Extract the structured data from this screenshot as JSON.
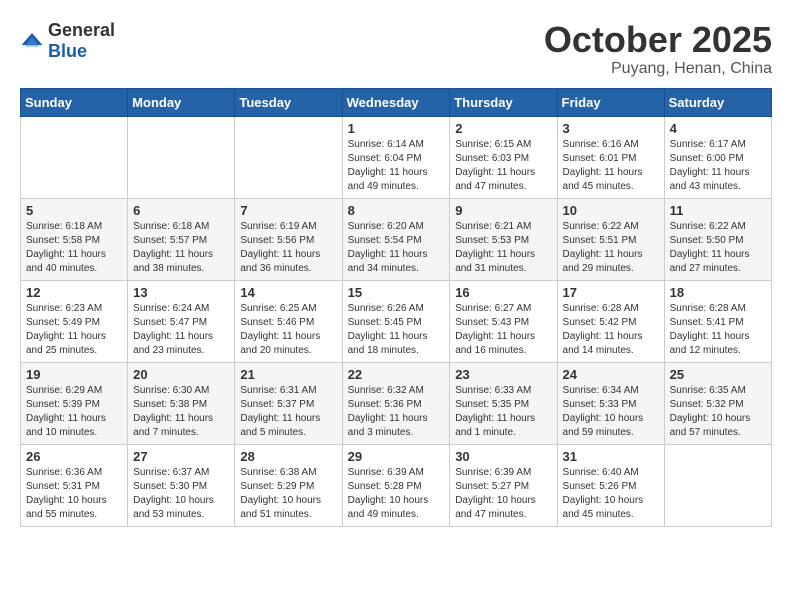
{
  "logo": {
    "general": "General",
    "blue": "Blue"
  },
  "header": {
    "month": "October 2025",
    "location": "Puyang, Henan, China"
  },
  "weekdays": [
    "Sunday",
    "Monday",
    "Tuesday",
    "Wednesday",
    "Thursday",
    "Friday",
    "Saturday"
  ],
  "weeks": [
    [
      {
        "day": "",
        "info": ""
      },
      {
        "day": "",
        "info": ""
      },
      {
        "day": "",
        "info": ""
      },
      {
        "day": "1",
        "info": "Sunrise: 6:14 AM\nSunset: 6:04 PM\nDaylight: 11 hours and 49 minutes."
      },
      {
        "day": "2",
        "info": "Sunrise: 6:15 AM\nSunset: 6:03 PM\nDaylight: 11 hours and 47 minutes."
      },
      {
        "day": "3",
        "info": "Sunrise: 6:16 AM\nSunset: 6:01 PM\nDaylight: 11 hours and 45 minutes."
      },
      {
        "day": "4",
        "info": "Sunrise: 6:17 AM\nSunset: 6:00 PM\nDaylight: 11 hours and 43 minutes."
      }
    ],
    [
      {
        "day": "5",
        "info": "Sunrise: 6:18 AM\nSunset: 5:58 PM\nDaylight: 11 hours and 40 minutes."
      },
      {
        "day": "6",
        "info": "Sunrise: 6:18 AM\nSunset: 5:57 PM\nDaylight: 11 hours and 38 minutes."
      },
      {
        "day": "7",
        "info": "Sunrise: 6:19 AM\nSunset: 5:56 PM\nDaylight: 11 hours and 36 minutes."
      },
      {
        "day": "8",
        "info": "Sunrise: 6:20 AM\nSunset: 5:54 PM\nDaylight: 11 hours and 34 minutes."
      },
      {
        "day": "9",
        "info": "Sunrise: 6:21 AM\nSunset: 5:53 PM\nDaylight: 11 hours and 31 minutes."
      },
      {
        "day": "10",
        "info": "Sunrise: 6:22 AM\nSunset: 5:51 PM\nDaylight: 11 hours and 29 minutes."
      },
      {
        "day": "11",
        "info": "Sunrise: 6:22 AM\nSunset: 5:50 PM\nDaylight: 11 hours and 27 minutes."
      }
    ],
    [
      {
        "day": "12",
        "info": "Sunrise: 6:23 AM\nSunset: 5:49 PM\nDaylight: 11 hours and 25 minutes."
      },
      {
        "day": "13",
        "info": "Sunrise: 6:24 AM\nSunset: 5:47 PM\nDaylight: 11 hours and 23 minutes."
      },
      {
        "day": "14",
        "info": "Sunrise: 6:25 AM\nSunset: 5:46 PM\nDaylight: 11 hours and 20 minutes."
      },
      {
        "day": "15",
        "info": "Sunrise: 6:26 AM\nSunset: 5:45 PM\nDaylight: 11 hours and 18 minutes."
      },
      {
        "day": "16",
        "info": "Sunrise: 6:27 AM\nSunset: 5:43 PM\nDaylight: 11 hours and 16 minutes."
      },
      {
        "day": "17",
        "info": "Sunrise: 6:28 AM\nSunset: 5:42 PM\nDaylight: 11 hours and 14 minutes."
      },
      {
        "day": "18",
        "info": "Sunrise: 6:28 AM\nSunset: 5:41 PM\nDaylight: 11 hours and 12 minutes."
      }
    ],
    [
      {
        "day": "19",
        "info": "Sunrise: 6:29 AM\nSunset: 5:39 PM\nDaylight: 11 hours and 10 minutes."
      },
      {
        "day": "20",
        "info": "Sunrise: 6:30 AM\nSunset: 5:38 PM\nDaylight: 11 hours and 7 minutes."
      },
      {
        "day": "21",
        "info": "Sunrise: 6:31 AM\nSunset: 5:37 PM\nDaylight: 11 hours and 5 minutes."
      },
      {
        "day": "22",
        "info": "Sunrise: 6:32 AM\nSunset: 5:36 PM\nDaylight: 11 hours and 3 minutes."
      },
      {
        "day": "23",
        "info": "Sunrise: 6:33 AM\nSunset: 5:35 PM\nDaylight: 11 hours and 1 minute."
      },
      {
        "day": "24",
        "info": "Sunrise: 6:34 AM\nSunset: 5:33 PM\nDaylight: 10 hours and 59 minutes."
      },
      {
        "day": "25",
        "info": "Sunrise: 6:35 AM\nSunset: 5:32 PM\nDaylight: 10 hours and 57 minutes."
      }
    ],
    [
      {
        "day": "26",
        "info": "Sunrise: 6:36 AM\nSunset: 5:31 PM\nDaylight: 10 hours and 55 minutes."
      },
      {
        "day": "27",
        "info": "Sunrise: 6:37 AM\nSunset: 5:30 PM\nDaylight: 10 hours and 53 minutes."
      },
      {
        "day": "28",
        "info": "Sunrise: 6:38 AM\nSunset: 5:29 PM\nDaylight: 10 hours and 51 minutes."
      },
      {
        "day": "29",
        "info": "Sunrise: 6:39 AM\nSunset: 5:28 PM\nDaylight: 10 hours and 49 minutes."
      },
      {
        "day": "30",
        "info": "Sunrise: 6:39 AM\nSunset: 5:27 PM\nDaylight: 10 hours and 47 minutes."
      },
      {
        "day": "31",
        "info": "Sunrise: 6:40 AM\nSunset: 5:26 PM\nDaylight: 10 hours and 45 minutes."
      },
      {
        "day": "",
        "info": ""
      }
    ]
  ]
}
